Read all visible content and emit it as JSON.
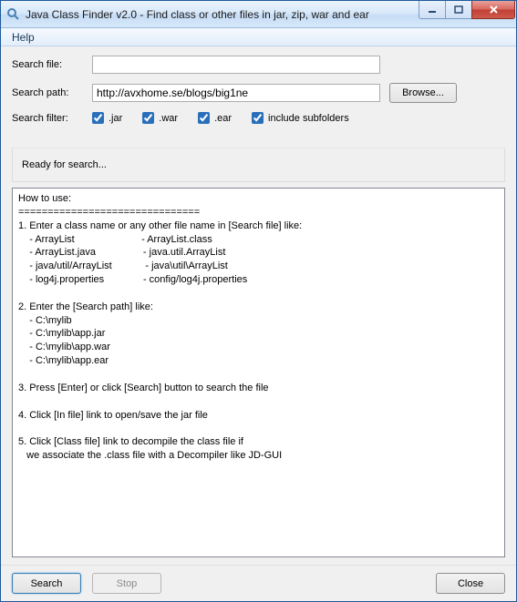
{
  "window": {
    "title": "Java Class Finder v2.0 - Find class or other files in jar, zip, war and ear"
  },
  "menubar": {
    "help": "Help"
  },
  "form": {
    "search_file_label": "Search file:",
    "search_file_value": "",
    "search_path_label": "Search path:",
    "search_path_value": "http://avxhome.se/blogs/big1ne",
    "browse_label": "Browse...",
    "search_filter_label": "Search filter:",
    "filters": {
      "jar": {
        "label": ".jar",
        "checked": true
      },
      "war": {
        "label": ".war",
        "checked": true
      },
      "ear": {
        "label": ".ear",
        "checked": true
      },
      "subfolders": {
        "label": "include subfolders",
        "checked": true
      }
    }
  },
  "status": {
    "text": "Ready for search..."
  },
  "results": {
    "text": "How to use:\n===============================\n1. Enter a class name or any other file name in [Search file] like:\n    - ArrayList                        - ArrayList.class\n    - ArrayList.java                 - java.util.ArrayList\n    - java/util/ArrayList            - java\\util\\ArrayList\n    - log4j.properties              - config/log4j.properties\n\n2. Enter the [Search path] like:\n    - C:\\mylib\n    - C:\\mylib\\app.jar\n    - C:\\mylib\\app.war\n    - C:\\mylib\\app.ear\n\n3. Press [Enter] or click [Search] button to search the file\n\n4. Click [In file] link to open/save the jar file\n\n5. Click [Class file] link to decompile the class file if\n   we associate the .class file with a Decompiler like JD-GUI"
  },
  "buttons": {
    "search": "Search",
    "stop": "Stop",
    "close": "Close"
  }
}
